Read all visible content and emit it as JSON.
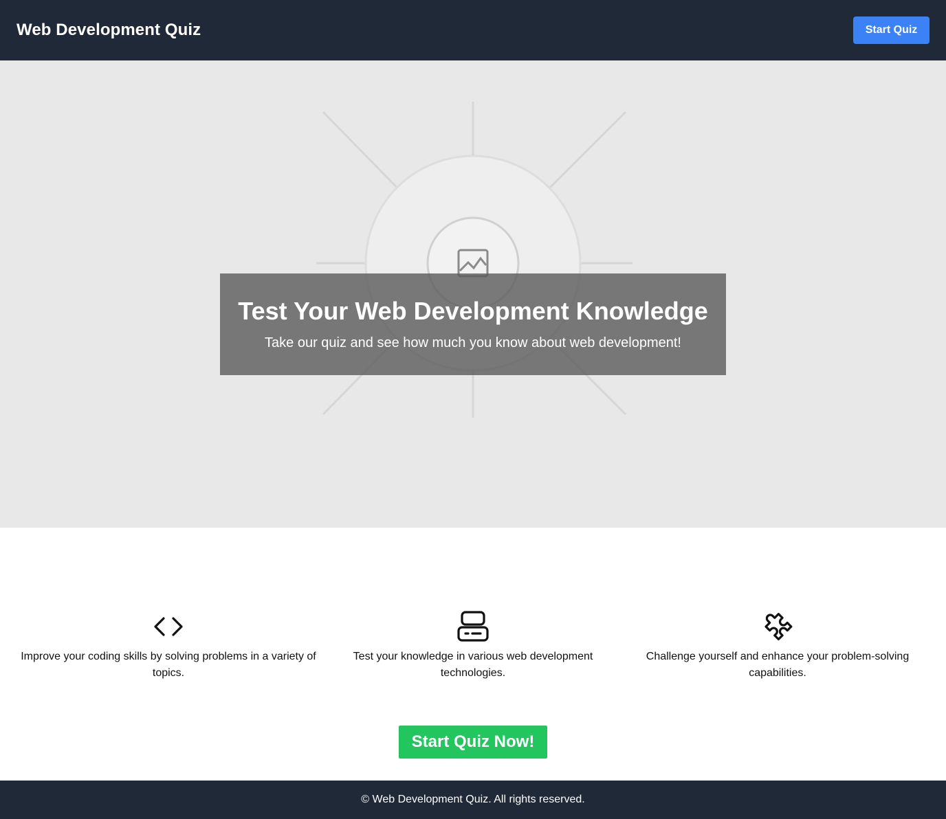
{
  "header": {
    "brand": "Web Development Quiz",
    "start_label": "Start Quiz"
  },
  "hero": {
    "image": "image-placeholder-icon",
    "title": "Test Your Web Development Knowledge",
    "subtitle": "Take our quiz and see how much you know about web development!"
  },
  "features": [
    {
      "icon": "code-icon",
      "text": "Improve your coding skills by solving problems in a variety of topics."
    },
    {
      "icon": "computer-icon",
      "text": "Test your knowledge in various web development technologies."
    },
    {
      "icon": "puzzle-icon",
      "text": "Challenge yourself and enhance your problem-solving capabilities."
    }
  ],
  "cta": {
    "label": "Start Quiz Now!"
  },
  "footer": {
    "text": "© Web Development Quiz. All rights reserved."
  },
  "colors": {
    "header_bg": "#1f2937",
    "primary_button": "#3b82f6",
    "cta_button": "#22c55e",
    "hero_bg": "#e8e8e8"
  }
}
